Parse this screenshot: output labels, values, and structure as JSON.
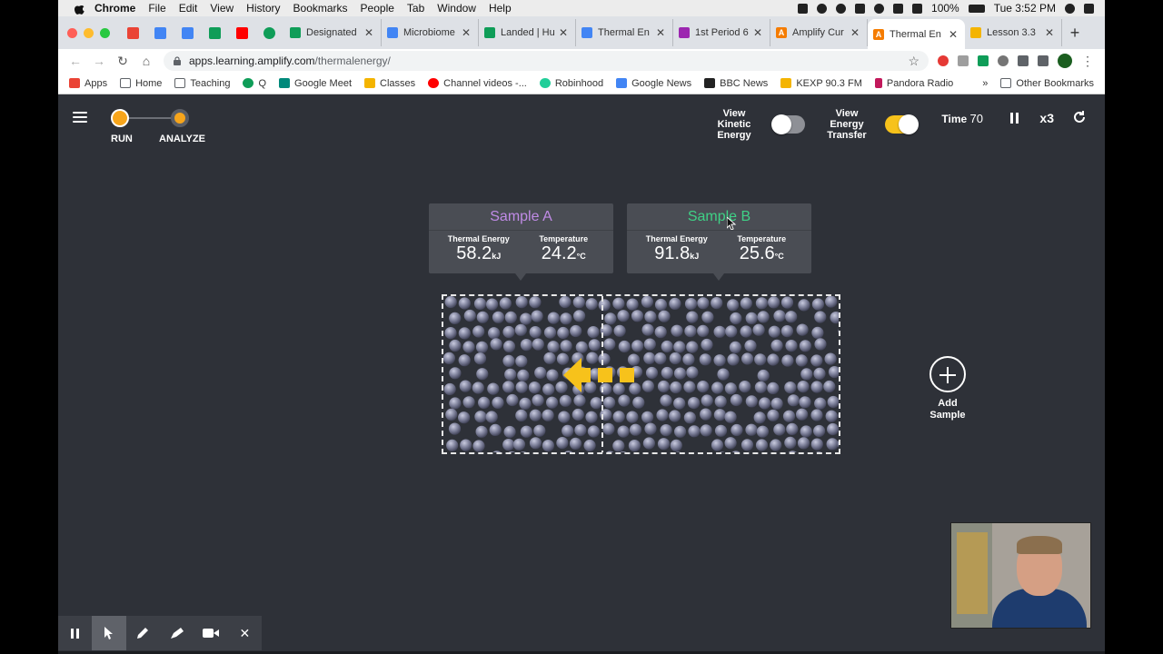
{
  "mac_menu": {
    "app": "Chrome",
    "items": [
      "File",
      "Edit",
      "View",
      "History",
      "Bookmarks",
      "People",
      "Tab",
      "Window",
      "Help"
    ],
    "battery": "100%",
    "clock": "Tue 3:52 PM"
  },
  "tabs": [
    {
      "label": "Designated",
      "color": "#0f9d58"
    },
    {
      "label": "Microbiome",
      "color": "#4285f4"
    },
    {
      "label": "Landed | Hu",
      "color": "#0f9d58"
    },
    {
      "label": "Thermal En",
      "color": "#4285f4"
    },
    {
      "label": "1st Period 6",
      "color": "#9c27b0"
    },
    {
      "label": "Amplify Cur",
      "color": "#f57c00"
    },
    {
      "label": "Thermal En",
      "color": "#f57c00",
      "active": true
    },
    {
      "label": "Lesson 3.3",
      "color": "#f4b400"
    }
  ],
  "address": {
    "domain": "apps.learning.amplify.com",
    "path": "/thermalenergy/"
  },
  "bookmarks": [
    {
      "label": "Apps",
      "color": "#ea4335"
    },
    {
      "label": "Home",
      "color": "#5f6368"
    },
    {
      "label": "Teaching",
      "color": "#5f6368"
    },
    {
      "label": "Q",
      "color": "#0f9d58"
    },
    {
      "label": "Google Meet",
      "color": "#00897b"
    },
    {
      "label": "Classes",
      "color": "#f4b400"
    },
    {
      "label": "Channel videos -...",
      "color": "#ff0000"
    },
    {
      "label": "Robinhood",
      "color": "#21ce99"
    },
    {
      "label": "Google News",
      "color": "#4285f4"
    },
    {
      "label": "BBC News",
      "color": "#222222"
    },
    {
      "label": "KEXP 90.3 FM",
      "color": "#f4b400"
    },
    {
      "label": "Pandora Radio",
      "color": "#c2185b"
    }
  ],
  "bookmarks_more": "»",
  "bookmarks_other": "Other Bookmarks",
  "stepper": {
    "run_label": "RUN",
    "analyze_label": "ANALYZE"
  },
  "controls": {
    "kinetic_label": "View Kinetic Energy",
    "kinetic_on": false,
    "transfer_label": "View Energy Transfer",
    "transfer_on": true,
    "time_label": "Time",
    "time_value": "70",
    "speed_label": "x3"
  },
  "samples": [
    {
      "name": "Sample A",
      "color": "#c08be6",
      "thermal_label": "Thermal Energy",
      "thermal_value": "58.2",
      "thermal_unit": "kJ",
      "temp_label": "Temperature",
      "temp_value": "24.2",
      "temp_unit": "°C"
    },
    {
      "name": "Sample B",
      "color": "#3fd186",
      "thermal_label": "Thermal Energy",
      "thermal_value": "91.8",
      "thermal_unit": "kJ",
      "temp_label": "Temperature",
      "temp_value": "25.6",
      "temp_unit": "°C"
    }
  ],
  "add_sample_label": "Add Sample",
  "energy_arrow_color": "#f7c21b"
}
